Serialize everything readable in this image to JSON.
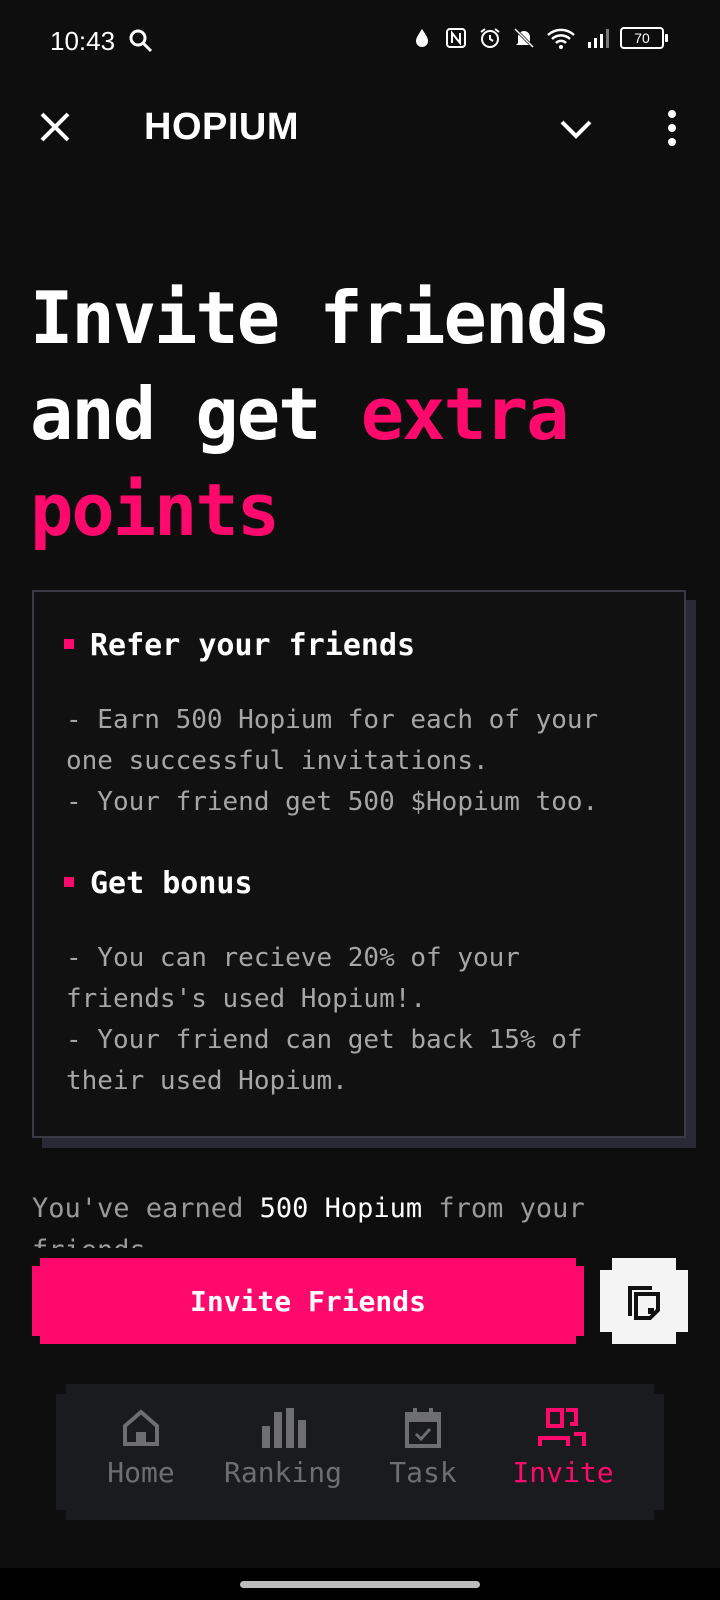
{
  "status_bar": {
    "time": "10:43",
    "battery": "70"
  },
  "app_bar": {
    "title": "HOPIUM"
  },
  "headline": {
    "line1": "Invite friends",
    "line2_plain": "and get ",
    "line2_accent": "extra",
    "line3_accent": "points"
  },
  "card": {
    "section1": {
      "title": "Refer your friends",
      "body": "- Earn 500 Hopium for each of your\none successful invitations.\n- Your friend get 500 $Hopium too."
    },
    "section2": {
      "title": "Get bonus",
      "body": "- You can recieve 20% of your\nfriends's used Hopium!.\n- Your friend can get back 15% of\ntheir used Hopium."
    }
  },
  "earned": {
    "prefix": "You've earned ",
    "amount": "500 Hopium",
    "suffix": " from your friends."
  },
  "actions": {
    "invite_label": "Invite Friends"
  },
  "nav": {
    "items": [
      {
        "label": "Home",
        "icon": "home-icon",
        "active": false
      },
      {
        "label": "Ranking",
        "icon": "ranking-icon",
        "active": false
      },
      {
        "label": "Task",
        "icon": "task-icon",
        "active": false
      },
      {
        "label": "Invite",
        "icon": "invite-icon",
        "active": true
      }
    ]
  },
  "colors": {
    "accent": "#ff0a6c",
    "background": "#0e0e0e",
    "card_border": "#3a3a44",
    "muted_text": "#a6a6a6",
    "nav_bg": "#1a1b1f"
  }
}
